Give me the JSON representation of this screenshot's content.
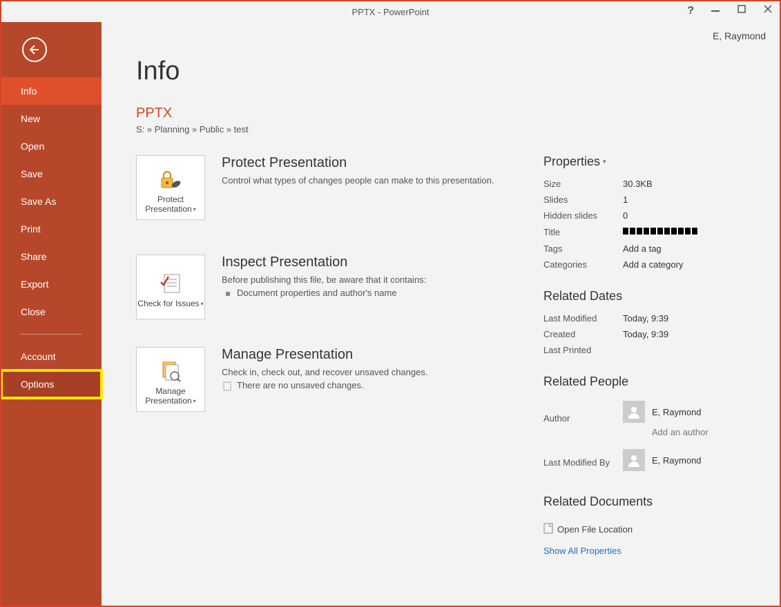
{
  "titlebar": {
    "app_title": "PPTX - PowerPoint",
    "user": "E,  Raymond"
  },
  "sidebar": {
    "items": [
      {
        "label": "Info",
        "state": "active"
      },
      {
        "label": "New"
      },
      {
        "label": "Open"
      },
      {
        "label": "Save"
      },
      {
        "label": "Save As"
      },
      {
        "label": "Print"
      },
      {
        "label": "Share"
      },
      {
        "label": "Export"
      },
      {
        "label": "Close"
      }
    ],
    "footer_items": [
      {
        "label": "Account"
      },
      {
        "label": "Options",
        "state": "hot",
        "highlight": true
      }
    ]
  },
  "main": {
    "page_title": "Info",
    "doc_name": "PPTX",
    "path": "S: » Planning » Public » test",
    "sections": [
      {
        "tile_label": "Protect Presentation",
        "title": "Protect Presentation",
        "desc": "Control what types of changes people can make to this presentation."
      },
      {
        "tile_label": "Check for Issues",
        "title": "Inspect Presentation",
        "desc": "Before publishing this file, be aware that it contains:",
        "bullet": "Document properties and author's name"
      },
      {
        "tile_label": "Manage Presentation",
        "title": "Manage Presentation",
        "desc": "Check in, check out, and recover unsaved changes.",
        "iconline": "There are no unsaved changes."
      }
    ]
  },
  "props": {
    "head": "Properties",
    "rows": [
      {
        "k": "Size",
        "v": "30.3KB"
      },
      {
        "k": "Slides",
        "v": "1"
      },
      {
        "k": "Hidden slides",
        "v": "0"
      },
      {
        "k": "Title",
        "v_redacted": true
      },
      {
        "k": "Tags",
        "v": "Add a tag",
        "placeholder": true
      },
      {
        "k": "Categories",
        "v": "Add a category",
        "placeholder": true
      }
    ],
    "dates_head": "Related Dates",
    "dates": [
      {
        "k": "Last Modified",
        "v": "Today, 9:39"
      },
      {
        "k": "Created",
        "v": "Today, 9:39"
      },
      {
        "k": "Last Printed",
        "v": ""
      }
    ],
    "people_head": "Related People",
    "author_k": "Author",
    "author_v": "E,  Raymond",
    "add_author": "Add an author",
    "mod_k": "Last Modified By",
    "mod_v": "E,  Raymond",
    "docs_head": "Related Documents",
    "file_loc": "Open File Location",
    "show_all": "Show All Properties"
  }
}
